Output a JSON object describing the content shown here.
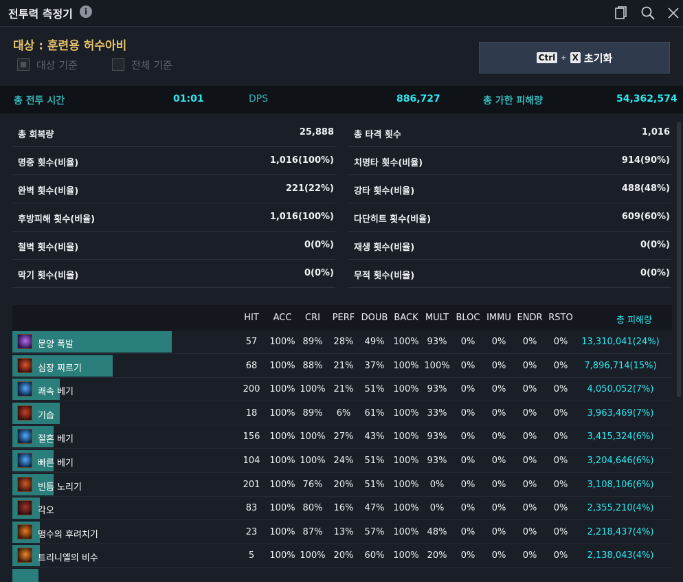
{
  "window": {
    "title": "전투력 측정기",
    "info_icon": "i"
  },
  "target": {
    "label": "대상 : 훈련용 허수아비",
    "options": [
      {
        "label": "대상 기준",
        "checked": true
      },
      {
        "label": "전체 기준",
        "checked": false
      }
    ],
    "reset": {
      "key1": "Ctrl",
      "plus": "+",
      "key2": "X",
      "label": "초기화"
    }
  },
  "summary": {
    "time_label": "총 전투 시간",
    "time_value": "01:01",
    "dps_label": "DPS",
    "dps_value": "886,727",
    "damage_label": "총 가한 피해량",
    "damage_value": "54,362,574"
  },
  "stats": [
    {
      "left_label": "총 회복량",
      "left_value": "25,888",
      "right_label": "총 타격 횟수",
      "right_value": "1,016"
    },
    {
      "left_label": "명중 횟수(비율)",
      "left_value": "1,016(100%)",
      "right_label": "치명타 횟수(비율)",
      "right_value": "914(90%)"
    },
    {
      "left_label": "완벽 횟수(비율)",
      "left_value": "221(22%)",
      "right_label": "강타 횟수(비율)",
      "right_value": "488(48%)"
    },
    {
      "left_label": "후방피해 횟수(비율)",
      "left_value": "1,016(100%)",
      "right_label": "다단히트 횟수(비율)",
      "right_value": "609(60%)"
    },
    {
      "left_label": "철벽 횟수(비율)",
      "left_value": "0(0%)",
      "right_label": "재생 횟수(비율)",
      "right_value": "0(0%)"
    },
    {
      "left_label": "막기 횟수(비율)",
      "left_value": "0(0%)",
      "right_label": "무적 횟수(비율)",
      "right_value": "0(0%)"
    }
  ],
  "table": {
    "columns": [
      "HIT",
      "ACC",
      "CRI",
      "PERF",
      "DOUB",
      "BACK",
      "MULT",
      "BLOC",
      "IMMU",
      "ENDR",
      "RSTO"
    ],
    "damage_header": "총 피해량",
    "rows": [
      {
        "name": "문양 폭발",
        "icon": "purple-burst-icon",
        "share": 0.24,
        "cells": [
          "57",
          "100%",
          "89%",
          "28%",
          "49%",
          "100%",
          "93%",
          "0%",
          "0%",
          "0%",
          "0%"
        ],
        "damage": "13,310,041(24%)"
      },
      {
        "name": "심장 찌르기",
        "icon": "red-stab-icon",
        "share": 0.15,
        "cells": [
          "68",
          "100%",
          "88%",
          "21%",
          "37%",
          "100%",
          "100%",
          "0%",
          "0%",
          "0%",
          "0%"
        ],
        "damage": "7,896,714(15%)"
      },
      {
        "name": "쾌속 베기",
        "icon": "blue-slash-icon",
        "share": 0.07,
        "cells": [
          "200",
          "100%",
          "100%",
          "21%",
          "51%",
          "100%",
          "93%",
          "0%",
          "0%",
          "0%",
          "0%"
        ],
        "damage": "4,050,052(7%)"
      },
      {
        "name": "기습",
        "icon": "red-ambush-icon",
        "share": 0.07,
        "cells": [
          "18",
          "100%",
          "89%",
          "6%",
          "61%",
          "100%",
          "33%",
          "0%",
          "0%",
          "0%",
          "0%"
        ],
        "damage": "3,963,469(7%)"
      },
      {
        "name": "절혼 베기",
        "icon": "blue-slash-icon",
        "share": 0.06,
        "cells": [
          "156",
          "100%",
          "100%",
          "27%",
          "43%",
          "100%",
          "93%",
          "0%",
          "0%",
          "0%",
          "0%"
        ],
        "damage": "3,415,324(6%)"
      },
      {
        "name": "빠른 베기",
        "icon": "blue-slash-icon",
        "share": 0.06,
        "cells": [
          "104",
          "100%",
          "100%",
          "24%",
          "51%",
          "100%",
          "93%",
          "0%",
          "0%",
          "0%",
          "0%"
        ],
        "damage": "3,204,646(6%)"
      },
      {
        "name": "빈틈 노리기",
        "icon": "red-strike-icon",
        "share": 0.06,
        "cells": [
          "201",
          "100%",
          "76%",
          "20%",
          "51%",
          "100%",
          "0%",
          "0%",
          "0%",
          "0%",
          "0%"
        ],
        "damage": "3,108,106(6%)"
      },
      {
        "name": "각오",
        "icon": "dark-red-icon",
        "share": 0.04,
        "cells": [
          "83",
          "100%",
          "80%",
          "16%",
          "47%",
          "100%",
          "0%",
          "0%",
          "0%",
          "0%",
          "0%"
        ],
        "damage": "2,355,210(4%)"
      },
      {
        "name": "맹수의 후려치기",
        "icon": "orange-claw-icon",
        "share": 0.04,
        "cells": [
          "23",
          "100%",
          "87%",
          "13%",
          "57%",
          "100%",
          "48%",
          "0%",
          "0%",
          "0%",
          "0%"
        ],
        "damage": "2,218,437(4%)"
      },
      {
        "name": "트리니엘의 비수",
        "icon": "orange-dagger-icon",
        "share": 0.04,
        "cells": [
          "5",
          "100%",
          "100%",
          "20%",
          "60%",
          "100%",
          "20%",
          "0%",
          "0%",
          "0%",
          "0%"
        ],
        "damage": "2,138,043(4%)"
      }
    ]
  },
  "colors": {
    "accent_teal": "#36b5b8",
    "accent_cyan": "#2ee8f2",
    "target_gold": "#e7c26a",
    "bar": "#2a7f7c"
  }
}
